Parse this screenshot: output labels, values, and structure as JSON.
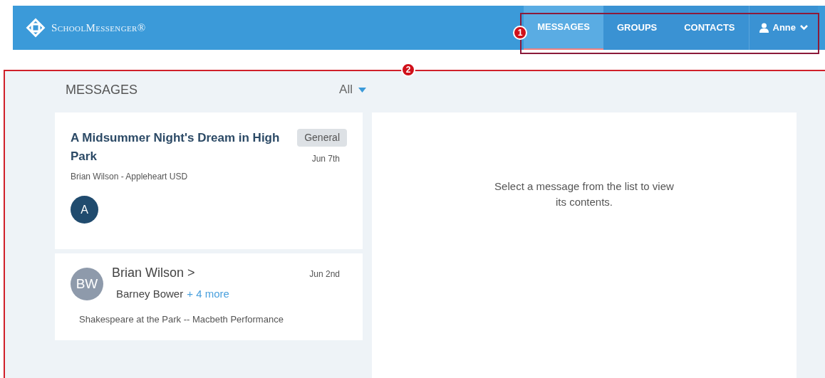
{
  "header": {
    "logo": "SchoolMessenger®",
    "nav": [
      {
        "label": "MESSAGES",
        "selected": true
      },
      {
        "label": "GROUPS",
        "selected": false
      },
      {
        "label": "CONTACTS",
        "selected": false
      }
    ],
    "user": {
      "name": "Anne"
    }
  },
  "callouts": [
    "1",
    "2"
  ],
  "messages_panel": {
    "title": "MESSAGES",
    "filter": "All",
    "items": [
      {
        "kind": "announcement",
        "title": "A Midsummer Night's Dream in High Park",
        "tag": "General",
        "date": "Jun 7th",
        "sender": "Brian Wilson - Appleheart USD",
        "avatar": "A"
      },
      {
        "kind": "conversation",
        "avatar": "BW",
        "from": "Brian Wilson >",
        "to": "Barney Bower",
        "more": "+ 4 more",
        "date": "Jun 2nd",
        "subject": "Shakespeare at the Park -- Macbeth Performance"
      }
    ]
  },
  "detail": {
    "empty_text": "Select a message from the list to view its contents."
  }
}
